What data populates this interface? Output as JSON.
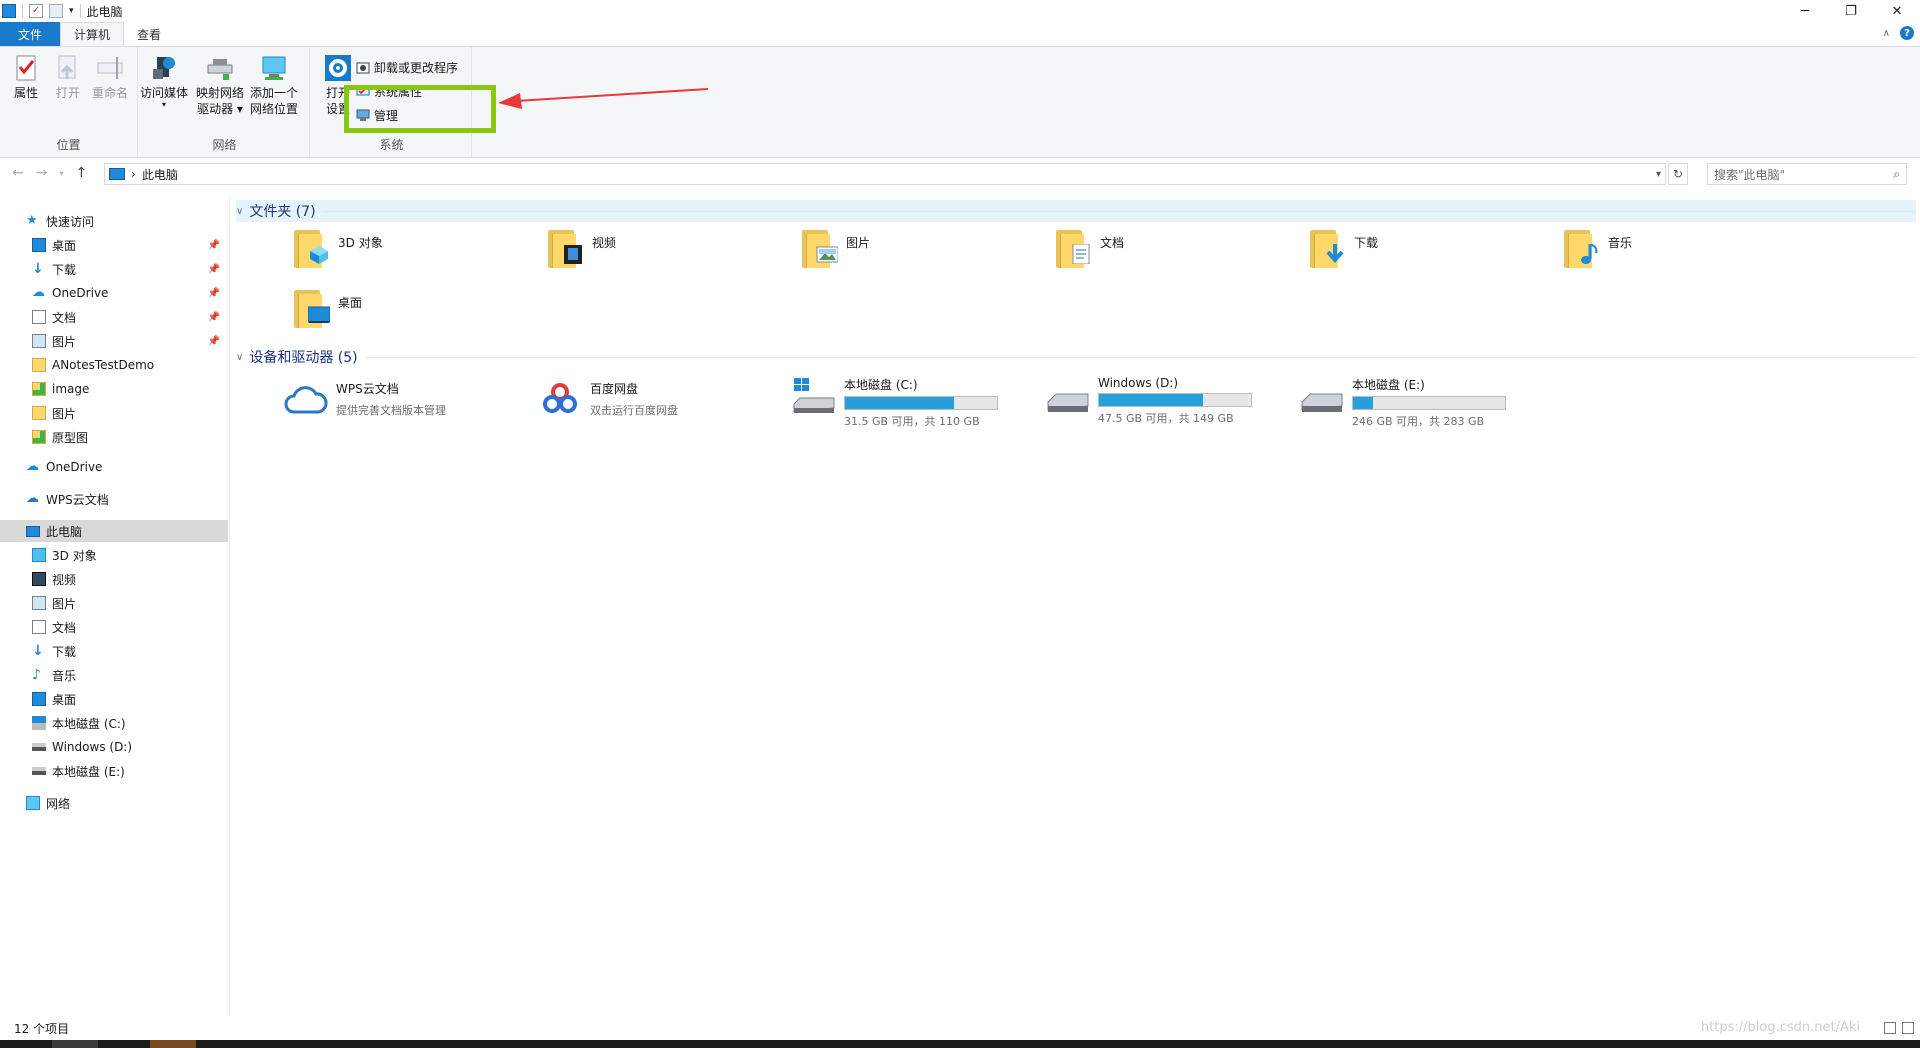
{
  "window": {
    "title": "此电脑",
    "minimize": "─",
    "restore": "❐",
    "close": "✕"
  },
  "ribbon_tabs": [
    {
      "label": "文件"
    },
    {
      "label": "计算机"
    },
    {
      "label": "查看"
    }
  ],
  "ribbon": {
    "location_group": {
      "label": "位置",
      "properties": "属性",
      "open": "打开",
      "rename": "重命名"
    },
    "network_group": {
      "label": "网络",
      "access_media": "访问媒体",
      "map_drive_l1": "映射网络",
      "map_drive_l2": "驱动器",
      "add_location_l1": "添加一个",
      "add_location_l2": "网络位置"
    },
    "system_group": {
      "label": "系统",
      "open_settings_l1": "打开",
      "open_settings_l2": "设置",
      "uninstall": "卸载或更改程序",
      "system_properties": "系统属性",
      "manage": "管理"
    },
    "highlight_color": "#8cc614",
    "arrow_color": "#e8393a"
  },
  "address_bar": {
    "path": "此电脑",
    "separator": "›",
    "search_placeholder": "搜索\"此电脑\""
  },
  "nav_pane": {
    "quick_access": "快速访问",
    "quick_items": [
      "桌面",
      "下载",
      "OneDrive",
      "文档",
      "图片",
      "ANotesTestDemo",
      "image",
      "图片",
      "原型图"
    ],
    "onedrive": "OneDrive",
    "wps": "WPS云文档",
    "this_pc": "此电脑",
    "pc_items": [
      "3D 对象",
      "视频",
      "图片",
      "文档",
      "下载",
      "音乐",
      "桌面",
      "本地磁盘 (C:)",
      "Windows (D:)",
      "本地磁盘 (E:)"
    ],
    "network": "网络"
  },
  "content": {
    "folders_header": "文件夹 (7)",
    "folders": [
      "3D 对象",
      "视频",
      "图片",
      "文档",
      "下载",
      "音乐",
      "桌面"
    ],
    "devices_header": "设备和驱动器 (5)",
    "cloud": [
      {
        "name": "WPS云文档",
        "sub": "提供完善文档版本管理"
      },
      {
        "name": "百度网盘",
        "sub": "双击运行百度网盘"
      }
    ],
    "drives": [
      {
        "name": "本地磁盘 (C:)",
        "free": "31.5 GB 可用，共 110 GB",
        "used_fraction": 0.714
      },
      {
        "name": "Windows (D:)",
        "free": "47.5 GB 可用，共 149 GB",
        "used_fraction": 0.681
      },
      {
        "name": "本地磁盘 (E:)",
        "free": "246 GB 可用，共 283 GB",
        "used_fraction": 0.131
      }
    ],
    "accent": "#26a0da"
  },
  "status": {
    "count": "12 个项目",
    "watermark": "https://blog.csdn.net/Aki"
  }
}
